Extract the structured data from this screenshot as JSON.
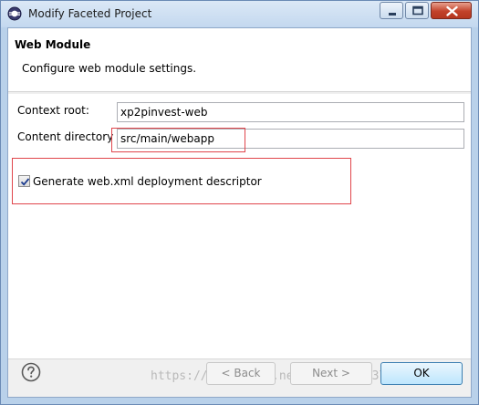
{
  "window": {
    "title": "Modify Faceted Project"
  },
  "header": {
    "title": "Web Module",
    "description": "Configure web module settings."
  },
  "form": {
    "context_root_label": "Context root:",
    "context_root_value": "xp2pinvest-web",
    "content_dir_label": "Content directory",
    "content_dir_value": "src/main/webapp",
    "generate_label": "Generate web.xml deployment descriptor",
    "generate_checked": true
  },
  "buttons": {
    "back": "< Back",
    "next": "Next >",
    "ok": "OK"
  },
  "watermark": "https://blog.csdn.net/zxd1435513775",
  "colors": {
    "highlight_box": "#e0454b",
    "titlebar": "#c3d8ef"
  },
  "icons": {
    "app": "eclipse-icon",
    "help": "help-icon",
    "minimize": "minimize-icon",
    "maximize": "maximize-icon",
    "close": "close-icon",
    "checkmark": "checkmark-icon"
  }
}
